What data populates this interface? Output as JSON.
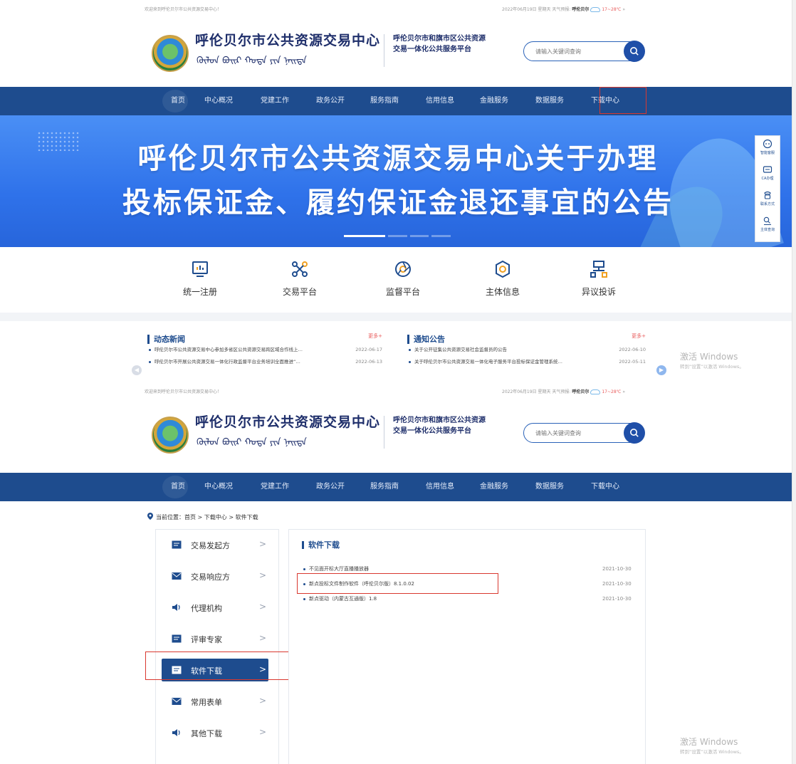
{
  "site": {
    "welcome": "欢迎来到呼伦贝尔市公共资源交易中心！",
    "weather": {
      "date": "2022年06月19日 星期天",
      "label": "天气预报:",
      "city": "呼伦贝尔",
      "temp": "17~28℃",
      "more": "»"
    },
    "org_name": "呼伦贝尔市公共资源交易中心",
    "mongolian_script": "ᠬᠥᠯᠦᠨ ᠪᠤᠢᠷ ᠬᠣᠳᠠ",
    "platform_title": "呼伦贝尔市和旗市区公共资源交易一体化公共服务平台",
    "search_placeholder": "请输入关键词查询"
  },
  "nav": {
    "items": [
      "首页",
      "中心概况",
      "党建工作",
      "政务公开",
      "服务指南",
      "信用信息",
      "金融服务",
      "数据服务",
      "下载中心"
    ]
  },
  "banner": {
    "line1": "呼伦贝尔市公共资源交易中心关于办理",
    "line2": "投标保证金、履约保证金退还事宜的公告"
  },
  "side_float": {
    "items": [
      "智能客服",
      "CA办理",
      "联系方式",
      "主体查询"
    ]
  },
  "quick_links": [
    "统一注册",
    "交易平台",
    "监督平台",
    "主体信息",
    "异议投诉"
  ],
  "news": {
    "title": "动态新闻",
    "more": "更多+",
    "items": [
      {
        "text": "呼伦贝尔市公共资源交易中心参加多省区公共资源交易跨区域合作线上…",
        "date": "2022-06-17"
      },
      {
        "text": "呼伦贝尔市开展公共资源交易一体化行政监督平台业务培训全面推进“…",
        "date": "2022-06-13"
      }
    ]
  },
  "notices": {
    "title": "通知公告",
    "more": "更多+",
    "items": [
      {
        "text": "关于公开征集公共资源交易社会监督员的公告",
        "date": "2022-06-10"
      },
      {
        "text": "关于呼伦贝尔市公共资源交易一体化电子服务平台投标保证金管理系统…",
        "date": "2022-05-11"
      }
    ]
  },
  "watermark": {
    "title": "激活 Windows",
    "subtitle": "转到“设置”以激活 Windows。"
  },
  "breadcrumb": "当前位置：首页 > 下载中心 > 软件下载",
  "side_menu": [
    {
      "label": "交易发起方",
      "icon": "document-icon",
      "active": false
    },
    {
      "label": "交易响应方",
      "icon": "envelope-icon",
      "active": false
    },
    {
      "label": "代理机构",
      "icon": "speaker-icon",
      "active": false
    },
    {
      "label": "评审专家",
      "icon": "document-icon",
      "active": false
    },
    {
      "label": "软件下载",
      "icon": "document-icon",
      "active": true
    },
    {
      "label": "常用表单",
      "icon": "envelope-icon",
      "active": false
    },
    {
      "label": "其他下载",
      "icon": "speaker-icon",
      "active": false
    }
  ],
  "menu_chevron": ">",
  "downloads": {
    "title": "软件下载",
    "items": [
      {
        "name": "不见面开标大厅直播播放器",
        "date": "2021-10-30"
      },
      {
        "name": "新点投标文件制作软件（呼伦贝尔版）8.1.0.02",
        "date": "2021-10-30"
      },
      {
        "name": "新点驱动（内蒙古互通版）1.8",
        "date": "2021-10-30"
      }
    ]
  },
  "colors": {
    "nav_blue": "#1e4c8e",
    "highlight_red": "#d9382f",
    "banner_blue": "#2f72ea"
  }
}
